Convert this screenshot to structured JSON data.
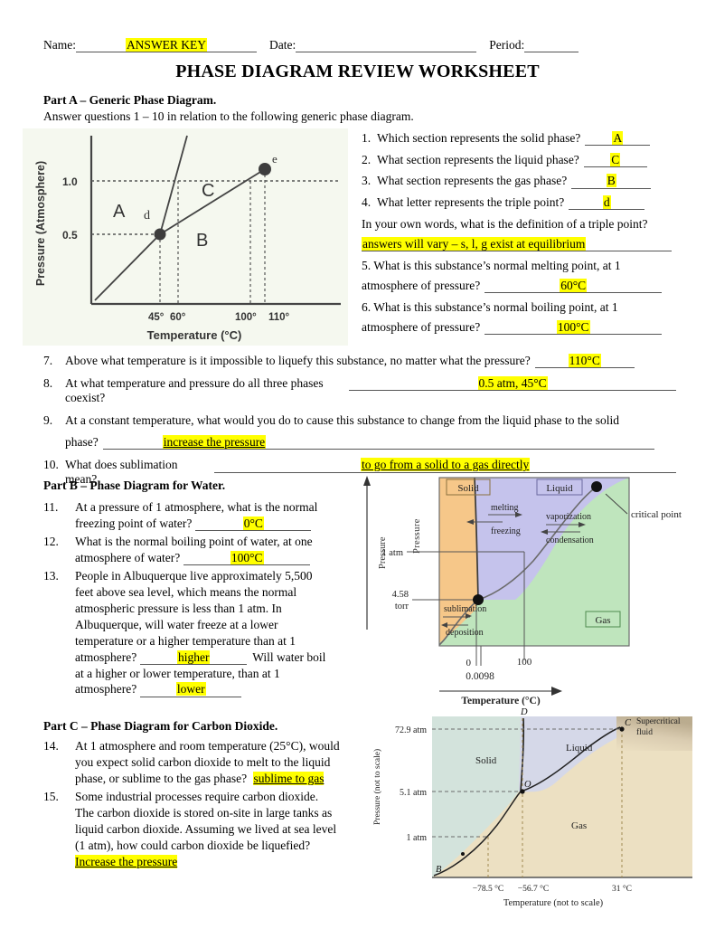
{
  "header": {
    "name_label": "Name:",
    "name_value": "ANSWER KEY",
    "date_label": "Date:",
    "date_value": "",
    "period_label": "Period:",
    "period_value": ""
  },
  "title": "PHASE DIAGRAM REVIEW WORKSHEET",
  "partA": {
    "heading": "Part A – Generic Phase Diagram.",
    "subheading": "Answer questions 1 – 10 in relation to the following generic phase diagram.",
    "questions": [
      {
        "num": "1.",
        "text": "Which section represents the solid phase?",
        "answer": "A"
      },
      {
        "num": "2.",
        "text": "What section represents the liquid phase?",
        "answer": "C"
      },
      {
        "num": "3.",
        "text": "What section represents the gas phase?",
        "answer": "B"
      },
      {
        "num": "4.",
        "text": "What letter represents the triple point?",
        "answer": "d"
      }
    ],
    "triple_point_prompt": "In your own words, what is the definition of a triple point?",
    "triple_point_answer": "answers will vary – s, l, g exist at equilibrium",
    "q5_line1": "5.   What is this substance’s normal melting point, at 1",
    "q5_line2": "atmosphere of pressure?",
    "q5_answer": "60°C",
    "q6_line1": "6.   What is this substance’s normal boiling point, at 1",
    "q6_line2": "atmosphere of pressure?",
    "q6_answer": "100°C",
    "lower": [
      {
        "num": "7.",
        "text": "Above what temperature is it impossible to liquefy this substance, no matter what the pressure?",
        "answer": "110°C"
      },
      {
        "num": "8.",
        "text": "At what temperature and pressure do all three phases coexist?",
        "answer": "0.5 atm, 45°C"
      },
      {
        "num": "9.",
        "text": "At a constant temperature, what would you do to cause this substance to change from the liquid phase to the solid",
        "text2": "phase?",
        "answer": "increase the pressure"
      },
      {
        "num": "10.",
        "text": "What does sublimation mean?",
        "answer": "to go from a solid to a gas directly"
      }
    ]
  },
  "partB": {
    "heading": "Part B – Phase Diagram for Water.",
    "q11": {
      "num": "11.",
      "line1": "At a pressure of 1 atmosphere, what is the normal",
      "line2": "freezing point of water?",
      "answer": "0°C"
    },
    "q12": {
      "num": "12.",
      "line1": "What is the normal boiling point of water, at one",
      "line2": "atmosphere of water?",
      "answer": "100°C"
    },
    "q13": {
      "num": "13.",
      "lines": [
        "People in Albuquerque live approximately 5,500",
        "feet above sea level, which means the normal",
        "atmospheric pressure is less than 1 atm.  In",
        "Albuquerque, will water freeze at a lower",
        "temperature or a higher temperature than at 1"
      ],
      "line_atm": "atmosphere?",
      "answer1": "higher",
      "tail1": "Will water boil",
      "line_next": "at a higher or lower temperature, than at 1",
      "line_atm2": "atmosphere?",
      "answer2": "lower"
    }
  },
  "partC": {
    "heading": "Part C – Phase Diagram for Carbon Dioxide.",
    "q14": {
      "num": "14.",
      "lines": [
        "At 1 atmosphere and room temperature (25°C), would",
        "you expect solid carbon dioxide to melt to the liquid"
      ],
      "line3": "phase, or sublime to the gas phase?",
      "answer": "sublime to gas"
    },
    "q15": {
      "num": "15.",
      "lines": [
        "Some industrial processes require carbon dioxide.",
        "The carbon dioxide is stored on-site in large tanks as",
        "liquid carbon dioxide.  Assuming we lived at sea level",
        "(1 atm), how could carbon dioxide be liquefied?"
      ],
      "answer": "Increase the pressure"
    }
  },
  "chart_data": [
    {
      "id": "generic-phase-diagram",
      "type": "line",
      "title": "",
      "xlabel": "Temperature (°C)",
      "ylabel": "Pressure (Atmosphere)",
      "ytick_labels": [
        "0.5",
        "1.0"
      ],
      "xtick_labels": [
        "45°",
        "60°",
        "100°",
        "110°"
      ],
      "region_labels": [
        "A",
        "B",
        "C"
      ],
      "point_labels": [
        "d",
        "e"
      ],
      "points": {
        "d": {
          "temp": 45,
          "pressure": 0.5,
          "note": "triple point"
        },
        "e": {
          "temp": 110,
          "pressure": 1.06,
          "note": "critical point"
        }
      },
      "dashed_guides": [
        "P = 1.0",
        "P = 0.5",
        "T = 45",
        "T = 60",
        "T = 100",
        "T = 110"
      ],
      "background": "#f5f8ef"
    },
    {
      "id": "water-phase-diagram",
      "type": "line",
      "xlabel": "Temperature (°C)",
      "ylabel": "Pressure",
      "ytick_labels": [
        "1 atm",
        "4.58 torr"
      ],
      "xtick_labels": [
        "0",
        "100",
        "0.0098"
      ],
      "region_labels": [
        "Solid",
        "Liquid",
        "Gas"
      ],
      "process_labels": [
        "melting",
        "freezing",
        "vaporization",
        "condensation",
        "sublimation",
        "deposition"
      ],
      "annotations": [
        "critical point"
      ],
      "colors": {
        "solid": "#f6c789",
        "liquid": "#c5c3ec",
        "gas": "#bfe5bd"
      }
    },
    {
      "id": "co2-phase-diagram",
      "type": "line",
      "xlabel": "Temperature (not to scale)",
      "ylabel": "Pressure (not to scale)",
      "ytick_labels": [
        "72.9 atm",
        "5.1 atm",
        "1 atm"
      ],
      "xtick_labels": [
        "−78.5 °C",
        "−56.7 °C",
        "31 °C"
      ],
      "region_labels": [
        "Solid",
        "Liquid",
        "Gas",
        "Supercritical fluid"
      ],
      "point_labels": [
        "B",
        "O",
        "C",
        "D"
      ],
      "colors": {
        "solid": "#d3e3dc",
        "liquid": "#d5d8e8",
        "gas": "#ece0c2"
      }
    }
  ]
}
